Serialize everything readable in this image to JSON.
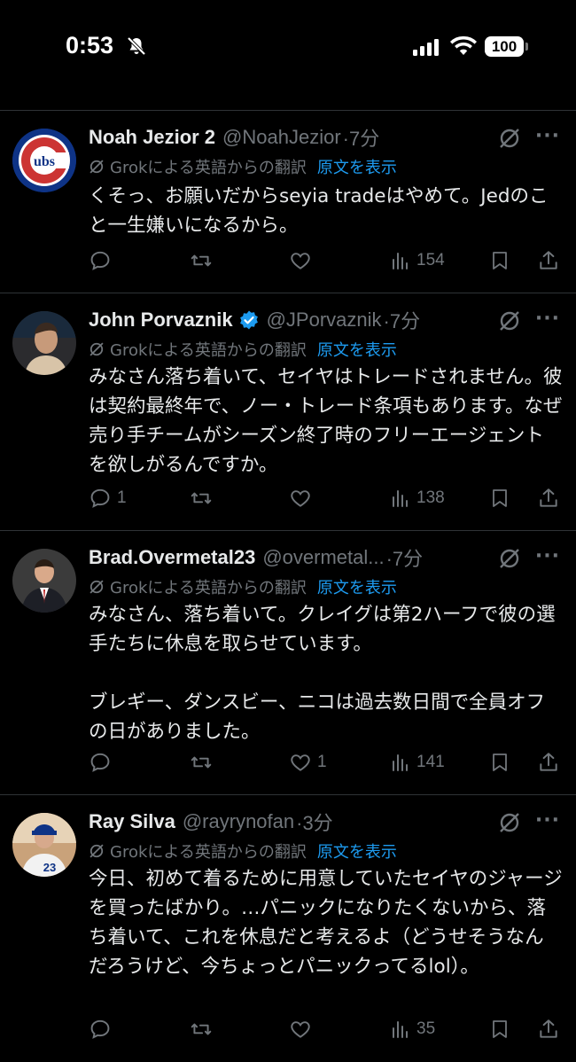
{
  "status_bar": {
    "time": "0:53",
    "battery": "100"
  },
  "tweets": [
    {
      "name": "Noah Jezior 2",
      "handle": "@NoahJezior",
      "time": "·7分",
      "translate_label": "Grokによる英語からの翻訳",
      "show_original": "原文を表示",
      "text": "くそっ、お願いだからseyia tradeはやめて。Jedのこと一生嫌いになるから。",
      "replies": "",
      "reposts": "",
      "likes": "",
      "views": "154",
      "verified": false
    },
    {
      "name": "John Porvaznik",
      "handle": "@JPorvaznik",
      "time": "·7分",
      "translate_label": "Grokによる英語からの翻訳",
      "show_original": "原文を表示",
      "text": "みなさん落ち着いて、セイヤはトレードされません。彼は契約最終年で、ノー・トレード条項もあります。なぜ売り手チームがシーズン終了時のフリーエージェントを欲しがるんですか。",
      "replies": "1",
      "reposts": "",
      "likes": "",
      "views": "138",
      "verified": true
    },
    {
      "name": "Brad.Overmetal23",
      "handle": "@overmetal...",
      "time": "·7分",
      "translate_label": "Grokによる英語からの翻訳",
      "show_original": "原文を表示",
      "text": "みなさん、落ち着いて。クレイグは第2ハーフで彼の選手たちに休息を取らせています。\n\nブレギー、ダンスビー、ニコは過去数日間で全員オフの日がありました。",
      "replies": "",
      "reposts": "",
      "likes": "1",
      "views": "141",
      "verified": false
    },
    {
      "name": "Ray Silva",
      "handle": "@rayrynofan",
      "time": "·3分",
      "translate_label": "Grokによる英語からの翻訳",
      "show_original": "原文を表示",
      "text": "今日、初めて着るために用意していたセイヤのジャージを買ったばかり。…パニックになりたくないから、落ち着いて、これを休息だと考えるよ（どうせそうなんだろうけど、今ちょっとパニックってるlol）。",
      "replies": "",
      "reposts": "",
      "likes": "",
      "views": "35",
      "verified": false
    }
  ],
  "icons": {
    "reply": "reply-icon",
    "repost": "repost-icon",
    "like": "like-icon",
    "views": "views-icon",
    "bookmark": "bookmark-icon",
    "share": "share-icon",
    "grok": "grok-icon",
    "more": "more-icon"
  },
  "colors": {
    "background": "#000000",
    "text": "#e7e9ea",
    "muted": "#71767b",
    "link": "#1d9bf0",
    "verified": "#1d9bf0"
  }
}
